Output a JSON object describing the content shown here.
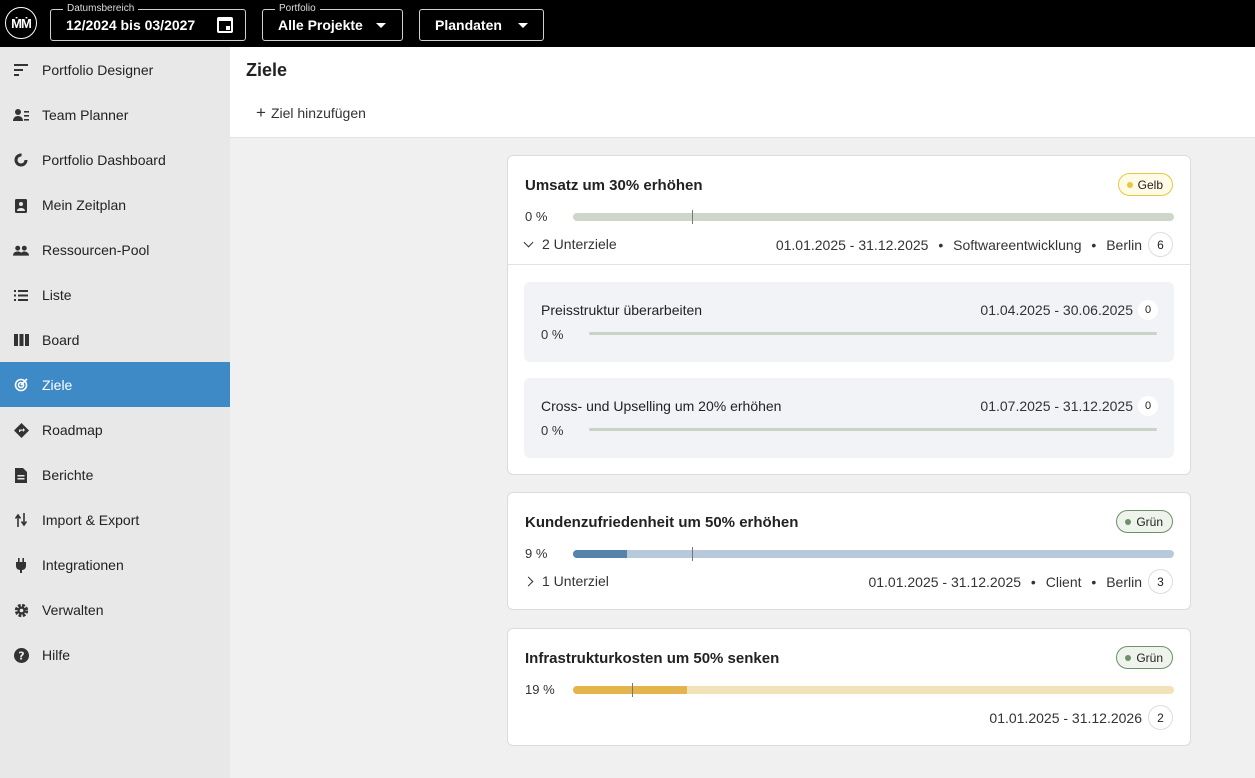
{
  "topbar": {
    "logo_text": "ṀṀ",
    "date_range": {
      "legend": "Datumsbereich",
      "value": "12/2024 bis 03/2027"
    },
    "portfolio": {
      "legend": "Portfolio",
      "value": "Alle Projekte"
    },
    "data_mode": {
      "value": "Plandaten"
    }
  },
  "sidebar": {
    "items": [
      {
        "label": "Portfolio Designer",
        "icon": "designer-icon"
      },
      {
        "label": "Team Planner",
        "icon": "team-icon"
      },
      {
        "label": "Portfolio Dashboard",
        "icon": "dashboard-icon"
      },
      {
        "label": "Mein Zeitplan",
        "icon": "schedule-icon"
      },
      {
        "label": "Ressourcen-Pool",
        "icon": "people-icon"
      },
      {
        "label": "Liste",
        "icon": "list-icon"
      },
      {
        "label": "Board",
        "icon": "board-icon"
      },
      {
        "label": "Ziele",
        "icon": "target-icon",
        "active": true
      },
      {
        "label": "Roadmap",
        "icon": "roadmap-icon"
      },
      {
        "label": "Berichte",
        "icon": "report-icon"
      },
      {
        "label": "Import & Export",
        "icon": "import-export-icon"
      },
      {
        "label": "Integrationen",
        "icon": "plug-icon"
      },
      {
        "label": "Verwalten",
        "icon": "gear-icon"
      },
      {
        "label": "Hilfe",
        "icon": "help-icon"
      }
    ]
  },
  "main": {
    "title": "Ziele",
    "add_button": "Ziel hinzufügen",
    "goals": [
      {
        "title": "Umsatz um 30% erhöhen",
        "status": "Gelb",
        "status_color": "#e8c840",
        "progress_text": "0 %",
        "progress": 0,
        "subgoals_label": "2 Unterziele",
        "date_range": "01.01.2025 - 31.12.2025",
        "department": "Softwareentwicklung",
        "location": "Berlin",
        "count": "6",
        "subgoals": [
          {
            "title": "Preisstruktur überarbeiten",
            "date_range": "01.04.2025 - 30.06.2025",
            "count": "0",
            "progress_text": "0 %"
          },
          {
            "title": "Cross- und Upselling um 20% erhöhen",
            "date_range": "01.07.2025 - 31.12.2025",
            "count": "0",
            "progress_text": "0 %"
          }
        ]
      },
      {
        "title": "Kundenzufriedenheit um 50% erhöhen",
        "status": "Grün",
        "status_color": "#6f8f6a",
        "progress_text": "9 %",
        "progress": 9,
        "subgoals_label": "1 Unterziel",
        "date_range": "01.01.2025 - 31.12.2025",
        "department": "Client",
        "location": "Berlin",
        "count": "3"
      },
      {
        "title": "Infrastrukturkosten um 50% senken",
        "status": "Grün",
        "status_color": "#6f8f6a",
        "progress_text": "19 %",
        "progress": 19,
        "date_range": "01.01.2025 - 31.12.2026",
        "count": "2"
      }
    ],
    "separator": "•"
  }
}
